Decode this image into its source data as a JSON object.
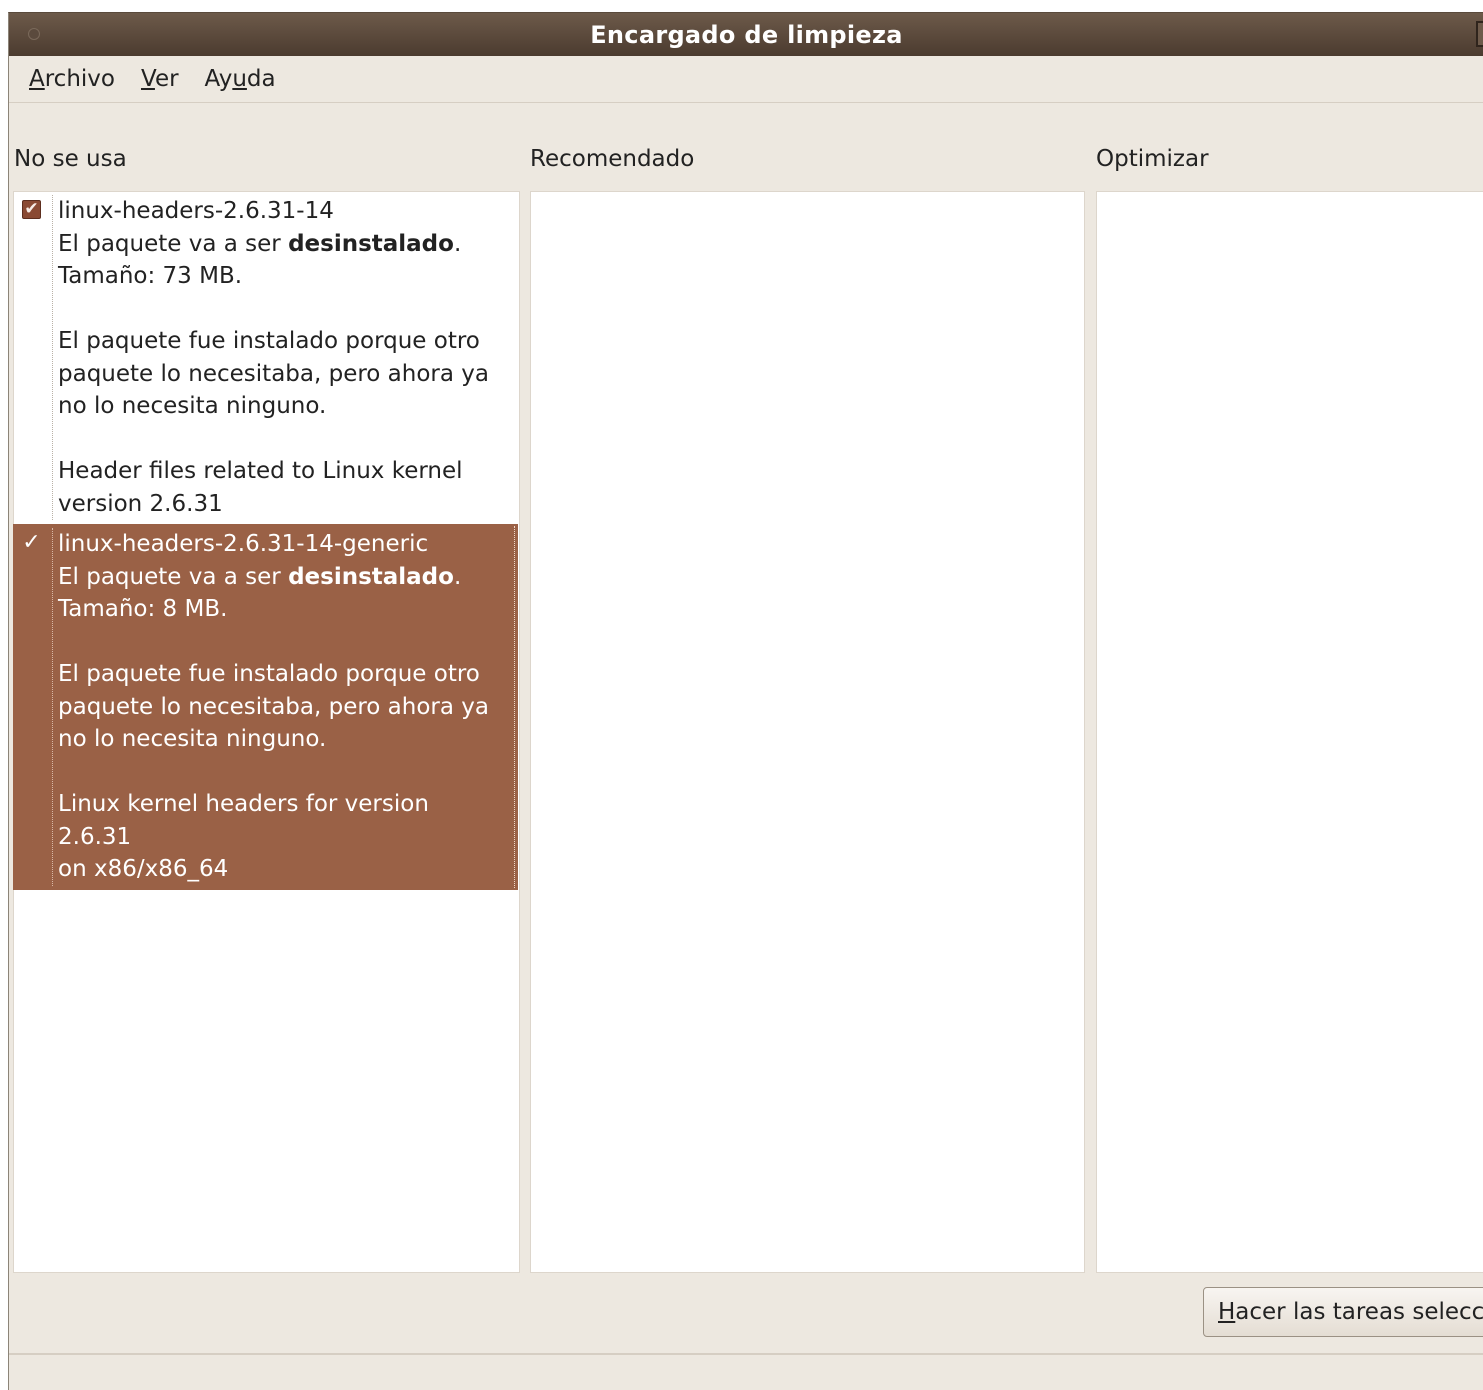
{
  "window": {
    "title": "Encargado de limpieza"
  },
  "menu": {
    "archivo": {
      "mnemonic": "A",
      "rest": "rchivo"
    },
    "ver": {
      "mnemonic": "V",
      "rest": "er"
    },
    "ayuda": {
      "pre": "Ay",
      "mnemonic": "u",
      "rest": "da"
    }
  },
  "columns": {
    "unused": "No se usa",
    "recommended": "Recomendado",
    "optimize": "Optimizar"
  },
  "unused_packages": [
    {
      "name": "linux-headers-2.6.31-14",
      "action_prefix": "El paquete va a ser ",
      "action_bold": "desinstalado",
      "action_suffix": ".",
      "size": "Tamaño: 73 MB.",
      "reason_1": "El paquete fue instalado porque otro",
      "reason_2": "paquete lo necesitaba, pero ahora ya",
      "reason_3": "no lo necesita ninguno.",
      "desc_1": "Header files related to Linux kernel",
      "desc_2": "version 2.6.31",
      "checked": true,
      "selected": false
    },
    {
      "name": "linux-headers-2.6.31-14-generic",
      "action_prefix": "El paquete va a ser ",
      "action_bold": "desinstalado",
      "action_suffix": ".",
      "size": "Tamaño: 8 MB.",
      "reason_1": "El paquete fue instalado porque otro",
      "reason_2": "paquete lo necesitaba, pero ahora ya",
      "reason_3": "no lo necesita ninguno.",
      "desc_1": "Linux kernel headers for version 2.6.31",
      "desc_2": "on x86/x86_64",
      "checked": true,
      "selected": true
    }
  ],
  "actions": {
    "do_tasks": {
      "mnemonic": "H",
      "rest": "acer las tareas selecc"
    }
  },
  "colors": {
    "selection": "#9a6146",
    "titlebar": "#5a4838",
    "window_bg": "#ede8e0"
  },
  "icons": {
    "check": "✔",
    "check_selected": "✓"
  }
}
